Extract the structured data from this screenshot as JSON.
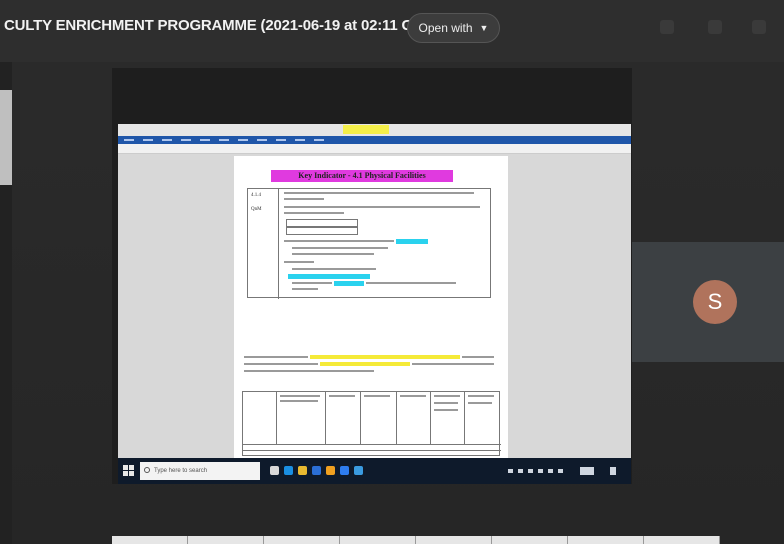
{
  "header": {
    "title": "CULTY ENRICHMENT PROGRAMME (2021-06-19 at 02:11 GMT-7)",
    "open_with_label": "Open with",
    "open_with_icon": "caret-down-icon"
  },
  "remote_document": {
    "heading": "Key Indicator - 4.1 Physical Facilities",
    "row_ids": [
      "4.1.4",
      "QnM"
    ],
    "highlight_colors": {
      "heading": "#e03adf",
      "cyan": "#2ad2ee",
      "yellow": "#f5ea38"
    }
  },
  "taskbar": {
    "search_placeholder": "Type here to search"
  },
  "participant": {
    "avatar_letter": "S",
    "avatar_color": "#b0735c"
  }
}
